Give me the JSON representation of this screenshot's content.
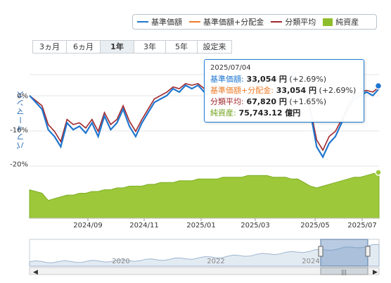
{
  "legend": {
    "items": [
      {
        "label": "基準価額",
        "color": "#1f77d0",
        "kind": "line"
      },
      {
        "label": "基準価額+分配金",
        "color": "#ee7d2a",
        "kind": "line"
      },
      {
        "label": "分類平均",
        "color": "#a0272c",
        "kind": "line"
      },
      {
        "label": "純資産",
        "color": "#8ebd2c",
        "kind": "box"
      }
    ]
  },
  "range_buttons": [
    {
      "label": "3ヵ月",
      "active": false
    },
    {
      "label": "6ヵ月",
      "active": false
    },
    {
      "label": "1年",
      "active": true
    },
    {
      "label": "3年",
      "active": false
    },
    {
      "label": "5年",
      "active": false
    },
    {
      "label": "設定来",
      "active": false
    }
  ],
  "y_axis_label": "パフォーマンス",
  "tooltip": {
    "date": "2025/07/04",
    "rows": [
      {
        "label": "基準価額:",
        "value": "33,054 円",
        "change": "(+2.69%)",
        "color": "#1f77d0"
      },
      {
        "label": "基準価額+分配金:",
        "value": "33,054 円",
        "change": "(+2.69%)",
        "color": "#ee7d2a"
      },
      {
        "label": "分類平均:",
        "value": "67,820 円",
        "change": "(+1.65%)",
        "color": "#a0272c"
      },
      {
        "label": "純資産:",
        "value": "75,743.12 億円",
        "change": "",
        "color": "#6fa11a"
      }
    ]
  },
  "navigator": {
    "x_tick_labels": [
      "2020",
      "2022",
      "2024"
    ]
  },
  "chart_data": {
    "type": "line",
    "x_tick_labels": [
      "2024/09",
      "2024/11",
      "2025/01",
      "2025/03",
      "2025/05",
      "2025/07"
    ],
    "y_tick_labels": [
      "0%",
      "-10%",
      "-20%"
    ],
    "yticks": [
      0,
      -10,
      -20
    ],
    "ylim": [
      -21.5,
      9
    ],
    "series": [
      {
        "name": "基準価額",
        "color": "#1f77d0",
        "values": [
          0,
          -2,
          -4,
          -10,
          -12,
          -15,
          -8,
          -10,
          -9,
          -11,
          -8,
          -12,
          -6,
          -10,
          -8,
          -4,
          -9,
          -12,
          -8,
          -5,
          -2,
          -1,
          0,
          2,
          1,
          3,
          2,
          3,
          1,
          2,
          2,
          1,
          3,
          2,
          4,
          5,
          4,
          3,
          5,
          6,
          4,
          5,
          6,
          4,
          1,
          -5,
          -15,
          -18,
          -14,
          -12,
          -8,
          -4,
          -1,
          0,
          1,
          0,
          2
        ]
      },
      {
        "name": "基準価額+分配金",
        "color": "#ee7d2a",
        "values": [
          0,
          -2,
          -4,
          -10,
          -12,
          -15,
          -8,
          -10,
          -9,
          -11,
          -8,
          -12,
          -6,
          -10,
          -8,
          -4,
          -9,
          -12,
          -8,
          -5,
          -2,
          -1,
          0,
          2,
          1,
          3,
          2,
          3,
          1,
          2,
          2,
          1,
          3,
          2,
          4,
          5,
          4,
          3,
          5,
          6,
          4,
          5,
          6,
          4,
          1,
          -5,
          -15,
          -18,
          -14,
          -12,
          -8,
          -4,
          -1,
          0,
          1,
          0,
          2
        ]
      },
      {
        "name": "分類平均",
        "color": "#a0272c",
        "values": [
          0,
          -1.5,
          -3,
          -8.5,
          -10.5,
          -13.5,
          -7,
          -8.5,
          -8,
          -9.5,
          -7,
          -10.5,
          -5,
          -8.5,
          -7,
          -3,
          -7.5,
          -10.5,
          -7,
          -4,
          -1,
          0,
          1,
          2.5,
          2,
          3.5,
          3,
          3.5,
          2,
          3,
          3,
          2,
          3.5,
          3,
          4.5,
          5.5,
          4.5,
          4,
          5.5,
          6,
          4.5,
          5.5,
          6,
          4.5,
          2,
          -4,
          -13,
          -16,
          -12,
          -10.5,
          -7,
          -3,
          0,
          1,
          1.5,
          1,
          2.5
        ]
      },
      {
        "name": "純資産",
        "values": [
          66,
          65,
          64,
          60,
          61,
          62,
          63,
          63,
          64,
          64,
          65,
          65,
          66,
          66,
          67,
          67,
          68,
          68,
          68,
          69,
          69,
          70,
          70,
          70,
          71,
          71,
          71,
          72,
          72,
          72,
          72,
          73,
          73,
          73,
          73,
          74,
          74,
          74,
          74,
          73,
          73,
          73,
          72,
          72,
          70,
          68,
          67,
          68,
          69,
          70,
          71,
          72,
          73,
          73,
          74,
          75,
          75.7
        ]
      }
    ]
  }
}
